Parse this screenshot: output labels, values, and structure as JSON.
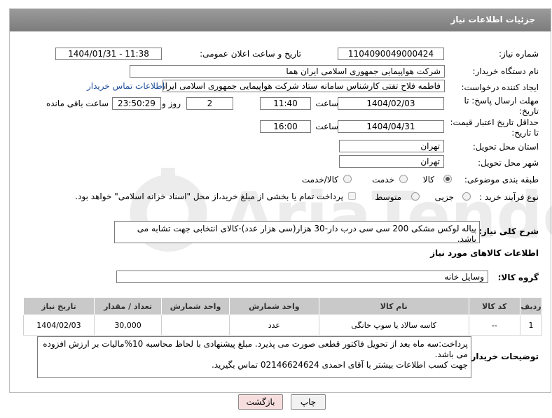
{
  "panel": {
    "title": "جزئیات اطلاعات نیاز"
  },
  "fields": {
    "need_number": {
      "label": "شماره نیاز:",
      "value": "1104090049000424"
    },
    "announce": {
      "label": "تاریخ و ساعت اعلان عمومی:",
      "value": "1404/01/31 - 11:38"
    },
    "buyer_org": {
      "label": "نام دستگاه خریدار:",
      "value": "شرکت هواپیمایی جمهوری اسلامی ایران هما"
    },
    "creator": {
      "label": "ایجاد کننده درخواست:",
      "value": "فاطمه فلاح تفتی کارشناس سامانه ستاد شرکت هواپیمایی جمهوری اسلامی ایران هما",
      "contact_link": "اطلاعات تماس خریدار"
    },
    "deadline": {
      "label": "مهلت ارسال پاسخ: تا تاریخ:",
      "date": "1404/02/03",
      "time_label": "ساعت",
      "time": "11:40",
      "days": "2",
      "days_label": "روز و",
      "remaining": "23:50:29",
      "remaining_label": "ساعت باقی مانده"
    },
    "validity": {
      "label": "حداقل تاریخ اعتبار قیمت: تا تاریخ:",
      "date": "1404/04/31",
      "time_label": "ساعت",
      "time": "16:00"
    },
    "province": {
      "label": "استان محل تحویل:",
      "value": "تهران"
    },
    "city": {
      "label": "شهر محل تحویل:",
      "value": "تهران"
    },
    "category": {
      "label": "طبقه بندی موضوعی:",
      "options": [
        "کالا",
        "خدمت",
        "کالا/خدمت"
      ],
      "selected": "کالا"
    },
    "process": {
      "label": "نوع فرآیند خرید :",
      "options": [
        "جزیی",
        "متوسط"
      ],
      "selected": "",
      "payment_note": "پرداخت تمام یا بخشی از مبلغ خرید،از محل \"اسناد خزانه اسلامی\" خواهد بود."
    },
    "description": {
      "label": "شرح کلی نیاز:",
      "value": "پیاله لوکس  مشکی 200 سی سی  درب دار-30 هزار(سی  هزار عدد)-کالای انتخابی جهت تشابه می باشد."
    }
  },
  "goods_section": {
    "title": "اطلاعات کالاهای مورد نیاز",
    "group_label": "گروه کالا:",
    "group_value": "وسایل خانه",
    "columns": [
      "ردیف",
      "کد کالا",
      "نام کالا",
      "واحد شمارش",
      "تعداد / مقدار",
      "تاریخ نیاز"
    ],
    "rows": [
      {
        "row": "1",
        "code": "--",
        "name": "کاسه سالاد یا سوپ خانگی",
        "unit": "عدد",
        "qty": "30,000",
        "date": "1404/02/03"
      }
    ]
  },
  "buyer_notes": {
    "label": "توضیحات خریدار:",
    "line1": "پرداخت:سه ماه بعد از تحویل فاکتور قطعی صورت می پذیرد. مبلغ پیشنهادی با لحاظ محاسبه 10%مالیات بر ارزش افزوده می باشد.",
    "line2": "جهت کسب اطلاعات بیشتر با آقای احمدی 02146624624 تماس بگیرید."
  },
  "buttons": {
    "print": "چاپ",
    "back": "بازگشت"
  },
  "watermark": {
    "text": "AriaTender.neT"
  },
  "colors": {
    "header": "#8a8a8a",
    "link": "#1f4e9b",
    "back_button": "#f7dede",
    "table_header": "#c9c9c9"
  }
}
